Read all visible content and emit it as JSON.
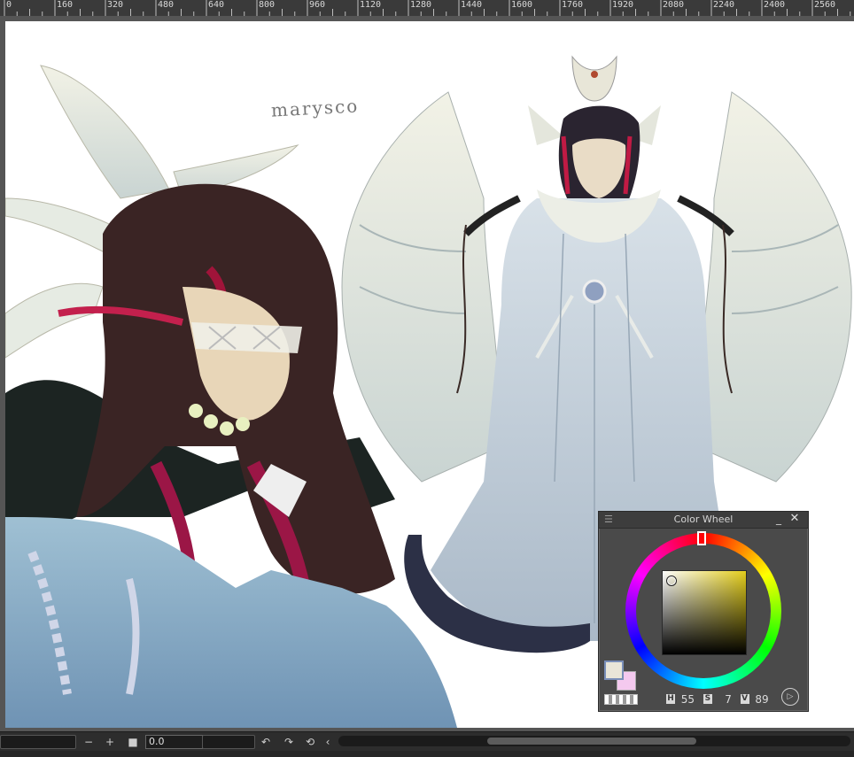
{
  "ruler": {
    "labels": [
      "0",
      "160",
      "320",
      "480",
      "640",
      "800",
      "960",
      "1120",
      "1280",
      "1440",
      "1600",
      "1760",
      "1920",
      "2080",
      "2240",
      "2400",
      "2560"
    ]
  },
  "canvas": {
    "signature": "marysco"
  },
  "color_wheel_panel": {
    "title": "Color Wheel",
    "menu_icon": "menu-icon",
    "minimize_icon": "minimize-icon",
    "close_icon": "close-icon",
    "hue_label": "H",
    "hue_value": "55",
    "saturation_label": "S",
    "saturation_value": "7",
    "value_label": "V",
    "value_value": "89",
    "main_color": "#e9e6d8",
    "sub_color": "#f4c9ef"
  },
  "bottom_bar": {
    "zoom_out": "−",
    "zoom_in": "+",
    "fit_icon": "square-icon",
    "zoom_value": "0.0",
    "rotate_left": "↶",
    "rotate_right": "↷",
    "reset_rotation": "⟲",
    "collapse": "‹"
  }
}
